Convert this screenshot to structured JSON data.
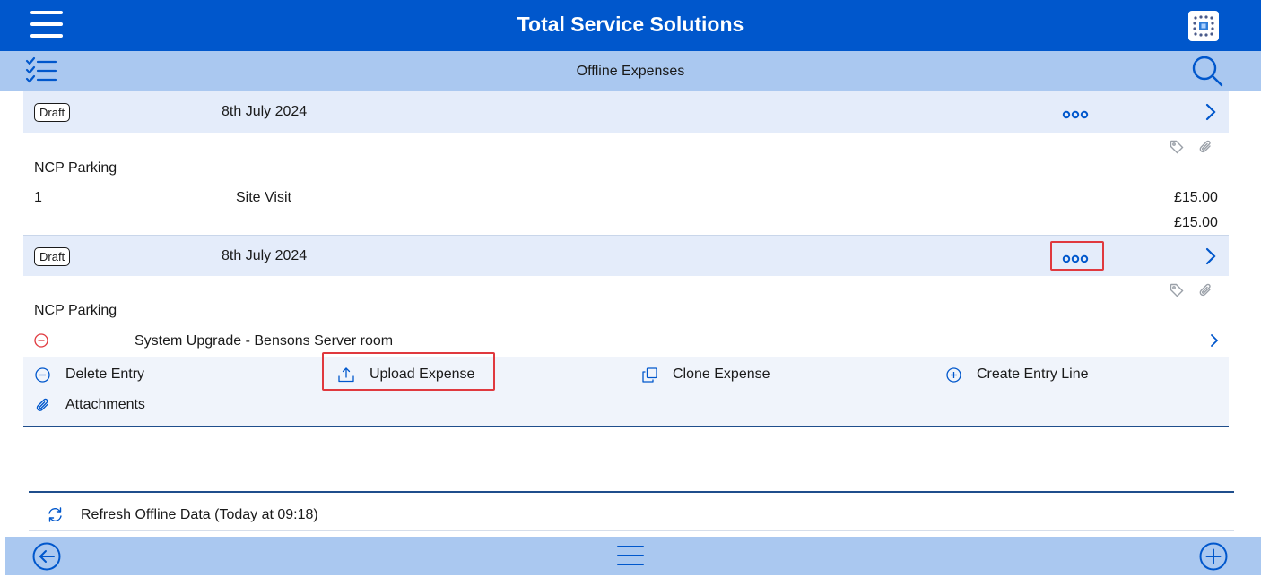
{
  "app": {
    "title": "Total Service Solutions"
  },
  "subheader": {
    "title": "Offline Expenses"
  },
  "entries": [
    {
      "status": "Draft",
      "date": "8th July 2024",
      "description": "NCP Parking",
      "line": {
        "number": "1",
        "text": "Site Visit",
        "amount": "£15.00"
      },
      "total": "£15.00"
    },
    {
      "status": "Draft",
      "date": "8th July 2024",
      "description": "NCP Parking",
      "line": {
        "text": "System Upgrade - Bensons Server room"
      }
    }
  ],
  "actions": {
    "delete": "Delete Entry",
    "upload": "Upload Expense",
    "clone": "Clone Expense",
    "create": "Create Entry Line",
    "attachments": "Attachments"
  },
  "refresh": {
    "label": "Refresh Offline Data (Today at 09:18)"
  },
  "colors": {
    "primary": "#0057cc",
    "secondary_bar": "#aac8f0",
    "row_bg": "#e4ecfa",
    "highlight": "#e0393e"
  },
  "icons": [
    "hamburger-icon",
    "logo-icon",
    "checklist-icon",
    "search-icon",
    "more-icon",
    "chevron-right-icon",
    "tag-icon",
    "paperclip-icon",
    "minus-circle-icon",
    "upload-icon",
    "copy-icon",
    "plus-circle-icon",
    "refresh-icon",
    "back-arrow-icon",
    "menu-icon"
  ]
}
